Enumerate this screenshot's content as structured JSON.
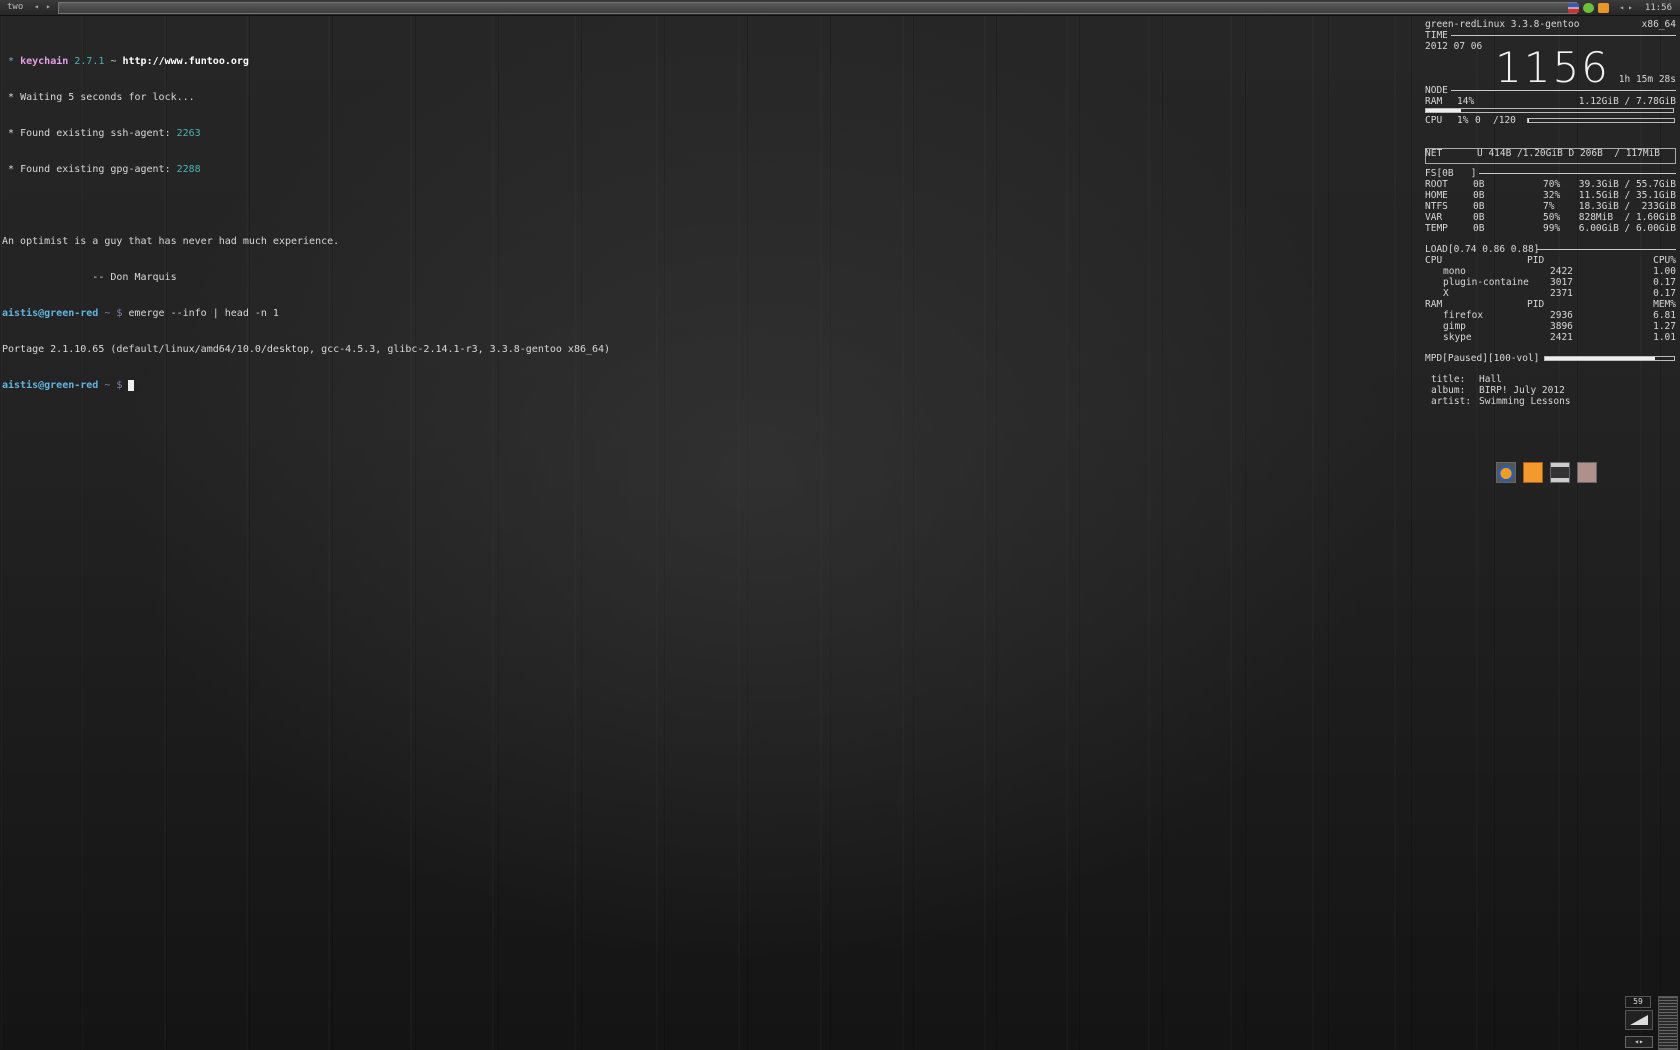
{
  "topbar": {
    "tag": "two",
    "prev_arrow": "◂",
    "next_arrow": "▸",
    "tray_arrow_left": "◂",
    "tray_arrow_right": "▸",
    "clock": "11:56",
    "tray_icons": [
      "us-flag-icon",
      "network-icon",
      "mail-icon"
    ]
  },
  "terminal": {
    "keychain_star": "*",
    "keychain_name": "keychain",
    "keychain_version": "2.7.1",
    "keychain_sep": "~",
    "keychain_url": "http://www.funtoo.org",
    "lock_line": "* Waiting 5 seconds for lock...",
    "ssh_line": "* Found existing ssh-agent: ",
    "ssh_pid": "2263",
    "gpg_line": "* Found existing gpg-agent: ",
    "gpg_pid": "2288",
    "quote": "An optimist is a guy that has never had much experience.",
    "quote_author": "               -- Don Marquis",
    "prompt_user": "aistis@green-red",
    "prompt_path": " ~ $ ",
    "command": "emerge --info | head -n 1",
    "output": "Portage 2.1.10.65 (default/linux/amd64/10.0/desktop, gcc-4.5.3, glibc-2.14.1-r3, 3.3.8-gentoo x86_64)"
  },
  "conky": {
    "host": "green-redLinux 3.3.8-gentoo",
    "arch": "x86_64",
    "time_label": "TIME",
    "date": "2012 07 06",
    "clock": "1156",
    "uptime": "1h 15m 28s",
    "node_label": "NODE",
    "ram_label": "RAM",
    "ram_percent": "14%",
    "ram_usage": "1.12GiB / 7.78GiB",
    "ram_fraction": 0.14,
    "cpu_label": "CPU",
    "cpu_percent": "1%",
    "cpu_val": "0",
    "cpu_max": "/120",
    "cpu_fraction": 0.01,
    "net_label": "NET",
    "net_stats": "U 414B /1.20GiB D 206B  / 117MiB",
    "fs_label": "FS[0B   ]",
    "fs_rows": [
      {
        "name": "ROOT",
        "io": "0B",
        "percent": "70%",
        "usage": "39.3GiB / 55.7GiB"
      },
      {
        "name": "HOME",
        "io": "0B",
        "percent": "32%",
        "usage": "11.5GiB / 35.1GiB"
      },
      {
        "name": "NTFS",
        "io": "0B",
        "percent": "7%",
        "usage": "18.3GiB /  233GiB"
      },
      {
        "name": "VAR",
        "io": "0B",
        "percent": "50%",
        "usage": "828MiB  / 1.60GiB"
      },
      {
        "name": "TEMP",
        "io": "0B",
        "percent": "99%",
        "usage": "6.00GiB / 6.00GiB"
      }
    ],
    "load_label": "LOAD[0.74 0.86 0.88]",
    "cpu_procs_header": {
      "label": "CPU",
      "pid": "PID",
      "metric": "CPU%"
    },
    "cpu_procs": [
      {
        "name": "mono",
        "pid": "2422",
        "value": "1.00"
      },
      {
        "name": "plugin-containe",
        "pid": "3017",
        "value": "0.17"
      },
      {
        "name": "X",
        "pid": "2371",
        "value": "0.17"
      }
    ],
    "ram_procs_header": {
      "label": "RAM",
      "pid": "PID",
      "metric": "MEM%"
    },
    "ram_procs": [
      {
        "name": "firefox",
        "pid": "2936",
        "value": "6.81"
      },
      {
        "name": "gimp",
        "pid": "3896",
        "value": "1.27"
      },
      {
        "name": "skype",
        "pid": "2421",
        "value": "1.01"
      }
    ],
    "mpd_label": "MPD[Paused][100-vol]",
    "mpd_volume_fraction": 0.85,
    "track": [
      {
        "key": "title:",
        "value": "Hall"
      },
      {
        "key": "album:",
        "value": "BIRP! July 2012"
      },
      {
        "key": "artist:",
        "value": "Swimming Lessons"
      }
    ]
  },
  "launcher": [
    "firefox-icon",
    "orange-app-icon",
    "terminal-icon",
    "file-manager-icon"
  ],
  "corner": {
    "volume": "59"
  },
  "colors": {
    "accent_blue": "#62b5e0",
    "teal": "#4ab3b3",
    "pink": "#e6a0e6"
  }
}
